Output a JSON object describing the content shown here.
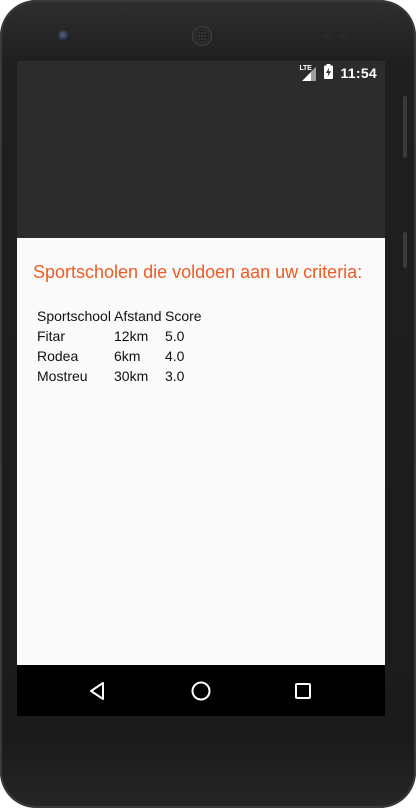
{
  "status_bar": {
    "network_label": "LTE",
    "time": "11:54"
  },
  "content": {
    "title": "Sportscholen die voldoen aan uw criteria:",
    "table": {
      "headers": [
        "Sportschool",
        "Afstand",
        "Score"
      ],
      "rows": [
        [
          "Fitar",
          "12km",
          "5.0"
        ],
        [
          "Rodea",
          "6km",
          "4.0"
        ],
        [
          "Mostreu",
          "30km",
          "3.0"
        ]
      ]
    }
  },
  "colors": {
    "title": "#ee5a24",
    "app_bar": "#2c2c2c",
    "content_bg": "#fafafa",
    "nav_bar": "#000000"
  },
  "icons": {
    "status": [
      "lte-signal-icon",
      "battery-charging-icon"
    ],
    "navigation": [
      "back-icon",
      "home-icon",
      "recent-apps-icon"
    ]
  }
}
